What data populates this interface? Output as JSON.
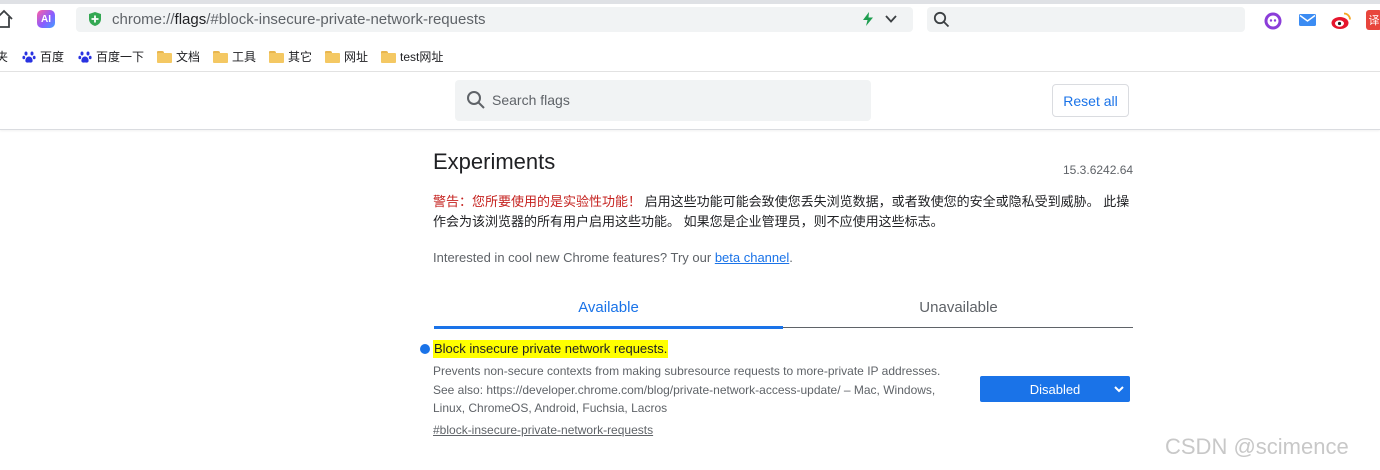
{
  "browser": {
    "url_prefix": "chrome://",
    "url_host": "flags",
    "url_path": "/#block-insecure-private-network-requests",
    "ai_button_label": "AI",
    "translate_label": "译",
    "icons": [
      "home-icon",
      "shield-icon",
      "bolt-icon",
      "chevron-down-icon",
      "search-icon",
      "ghost-extension-icon",
      "mail-icon",
      "weibo-icon"
    ]
  },
  "bookmarks": {
    "cut_label": "夹",
    "items": [
      {
        "label": "百度",
        "icon": "baidu-paw-icon"
      },
      {
        "label": "百度一下",
        "icon": "baidu-paw-icon"
      },
      {
        "label": "文档",
        "icon": "folder-icon"
      },
      {
        "label": "工具",
        "icon": "folder-icon"
      },
      {
        "label": "其它",
        "icon": "folder-icon"
      },
      {
        "label": "网址",
        "icon": "folder-icon"
      },
      {
        "label": "test网址",
        "icon": "folder-icon"
      }
    ]
  },
  "header": {
    "search_placeholder": "Search flags",
    "reset_label": "Reset all"
  },
  "main": {
    "title": "Experiments",
    "version": "15.3.6242.64",
    "warning_red": "警告：您所要使用的是实验性功能！",
    "warning_rest": " 启用这些功能可能会致使您丢失浏览数据，或者致使您的安全或隐私受到威胁。 此操作会为该浏览器的所有用户启用这些功能。 如果您是企业管理员，则不应使用这些标志。",
    "interest_text": "Interested in cool new Chrome features? Try our ",
    "interest_link": "beta channel",
    "interest_end": ".",
    "tabs": [
      {
        "label": "Available",
        "selected": true
      },
      {
        "label": "Unavailable",
        "selected": false
      }
    ]
  },
  "flag": {
    "name": "Block insecure private network requests.",
    "description": "Prevents non-secure contexts from making subresource requests to more-private IP addresses. See also: https://developer.chrome.com/blog/private-network-access-update/ – Mac, Windows, Linux, ChromeOS, Android, Fuchsia, Lacros",
    "anchor": "#block-insecure-private-network-requests",
    "selected_option": "Disabled",
    "highlight_color": "#ffff00",
    "accent_color": "#1a73e8"
  },
  "watermark": "CSDN @scimence"
}
